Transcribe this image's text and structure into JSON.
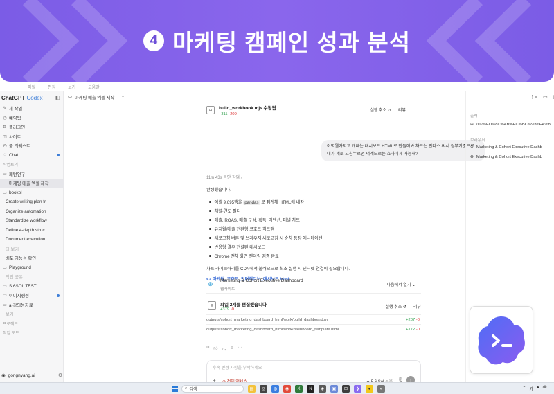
{
  "banner": {
    "step": "4",
    "title": "마케팅 캠페인 성과 분석"
  },
  "menu": [
    "파일",
    "편집",
    "보기",
    "도움말"
  ],
  "sidebar": {
    "brand": "ChatGPT",
    "brand_suffix": "Codex",
    "nav": [
      {
        "icon": "✎",
        "label": "새 작업"
      },
      {
        "icon": "◷",
        "label": "예약됨"
      },
      {
        "icon": "⊞",
        "label": "플러그인"
      },
      {
        "icon": "◫",
        "label": "사이트"
      },
      {
        "icon": "◴",
        "label": "풀 리퀘스트"
      },
      {
        "icon": "◌",
        "label": "Chat"
      }
    ],
    "section1": "작업트리",
    "group1": "패턴연구",
    "active_thread": "마케팅 매출 엑셀 제작",
    "folder": "bookpl",
    "threads": [
      "Create writing plan fr",
      "Organize automation",
      "Standardize workflow",
      "Define 4-depth struc",
      "Document execution"
    ],
    "more": "더 보기",
    "deploy": "배포 가능성 확인",
    "playground": "Playground",
    "prompt_review": "작업 공유",
    "extra": [
      "S.6SOL TEST",
      "이미지생성",
      "a-강의용자료"
    ],
    "more2": "보기",
    "project": "프로젝트",
    "tasks": "작업 모드",
    "user": "gongnyang.ai"
  },
  "main": {
    "thread_title": "마케팅 매출 엑셀 제작",
    "file_card": {
      "name": "build_workbook.mjs 수정됨",
      "add": "+311",
      "del": "-209",
      "undo": "실행 취소",
      "review": "리뷰"
    },
    "user_msg": "이벽웰가지고 개빠는 대시보드 HTML로 만들어봐 차트는 판다스 써서 썸부기준으로 내가 세로 고칭누르면 쩌레모르는 효과이게 가능해?",
    "worked_for": "11m 43s 동안 작업",
    "answer": {
      "intro": "완성했습니다.",
      "bullets": [
        {
          "pre": "엑셀 9,695행을 ",
          "chip": "pandas",
          "post": " 로 집계해 HTML에 내장"
        },
        {
          "pre": "채널·연도 필터",
          "chip": "",
          "post": ""
        },
        {
          "pre": "매출, ROAS, 매출 구성, 획득, 리텐션, 퍼널 차트",
          "chip": "",
          "post": ""
        },
        {
          "pre": "유치월/매출 전환형 코호트 히트맵",
          "chip": "",
          "post": ""
        },
        {
          "pre": "새로고침 버튼 및 브라우저 새로고침 시 순차 등장 애니메이션",
          "chip": "",
          "post": ""
        },
        {
          "pre": "반응형 결우 전설된 대시보드",
          "chip": "",
          "post": ""
        },
        {
          "pre": "Chrome 전체 화면 렌더링 검증 완료",
          "chip": "",
          "post": ""
        }
      ],
      "note": "차트 라이브러리를 CDN에서 불러오므로 최초 실행 시 인터넷 연결이 필요합니다.",
      "link": "<> 마케팅_코호트_인터랙티브_대시보드.html"
    },
    "dash_card": {
      "title": "Marketing & Cohort Executive Dashboard",
      "sub": "웹사이트",
      "open": "다음에서 열기"
    },
    "edit_card": {
      "title": "파일 2개를 편집했습니다",
      "add": "+379",
      "del": "-0",
      "undo": "실행 취소",
      "review": "리뷰",
      "files": [
        {
          "path": "outputs/cohort_marketing_dashboard_html/work/build_dashboard.py",
          "add": "+207",
          "del": "-0"
        },
        {
          "path": "outputs/cohort_marketing_dashboard_html/work/dashboard_template.html",
          "add": "+172",
          "del": "-0"
        }
      ]
    },
    "composer": {
      "placeholder": "후속 변경 사항을 부탁하세요",
      "access": "전체 액세스",
      "model": "5.6 Sol",
      "model_mode": "높음"
    }
  },
  "rpanel": {
    "section_output": "출력",
    "path": "/D:/%ED%8C%AB%EC%BC%90%EA%8",
    "section_browser": "브라우저",
    "tab1": "Marketing & Cohort Executive Dashb",
    "tab2": "Marketing & Cohort Executive Dashb"
  },
  "taskbar": {
    "search": "검색",
    "lang": "가",
    "wifi": "●",
    "time": "dk"
  },
  "colors": {
    "banner": "#7b5ce6",
    "accent": "#3d7ed8",
    "add": "#2e9e4c",
    "del": "#d33",
    "logo_grad_start": "#4f6df5",
    "logo_grad_end": "#8a5cf0"
  }
}
